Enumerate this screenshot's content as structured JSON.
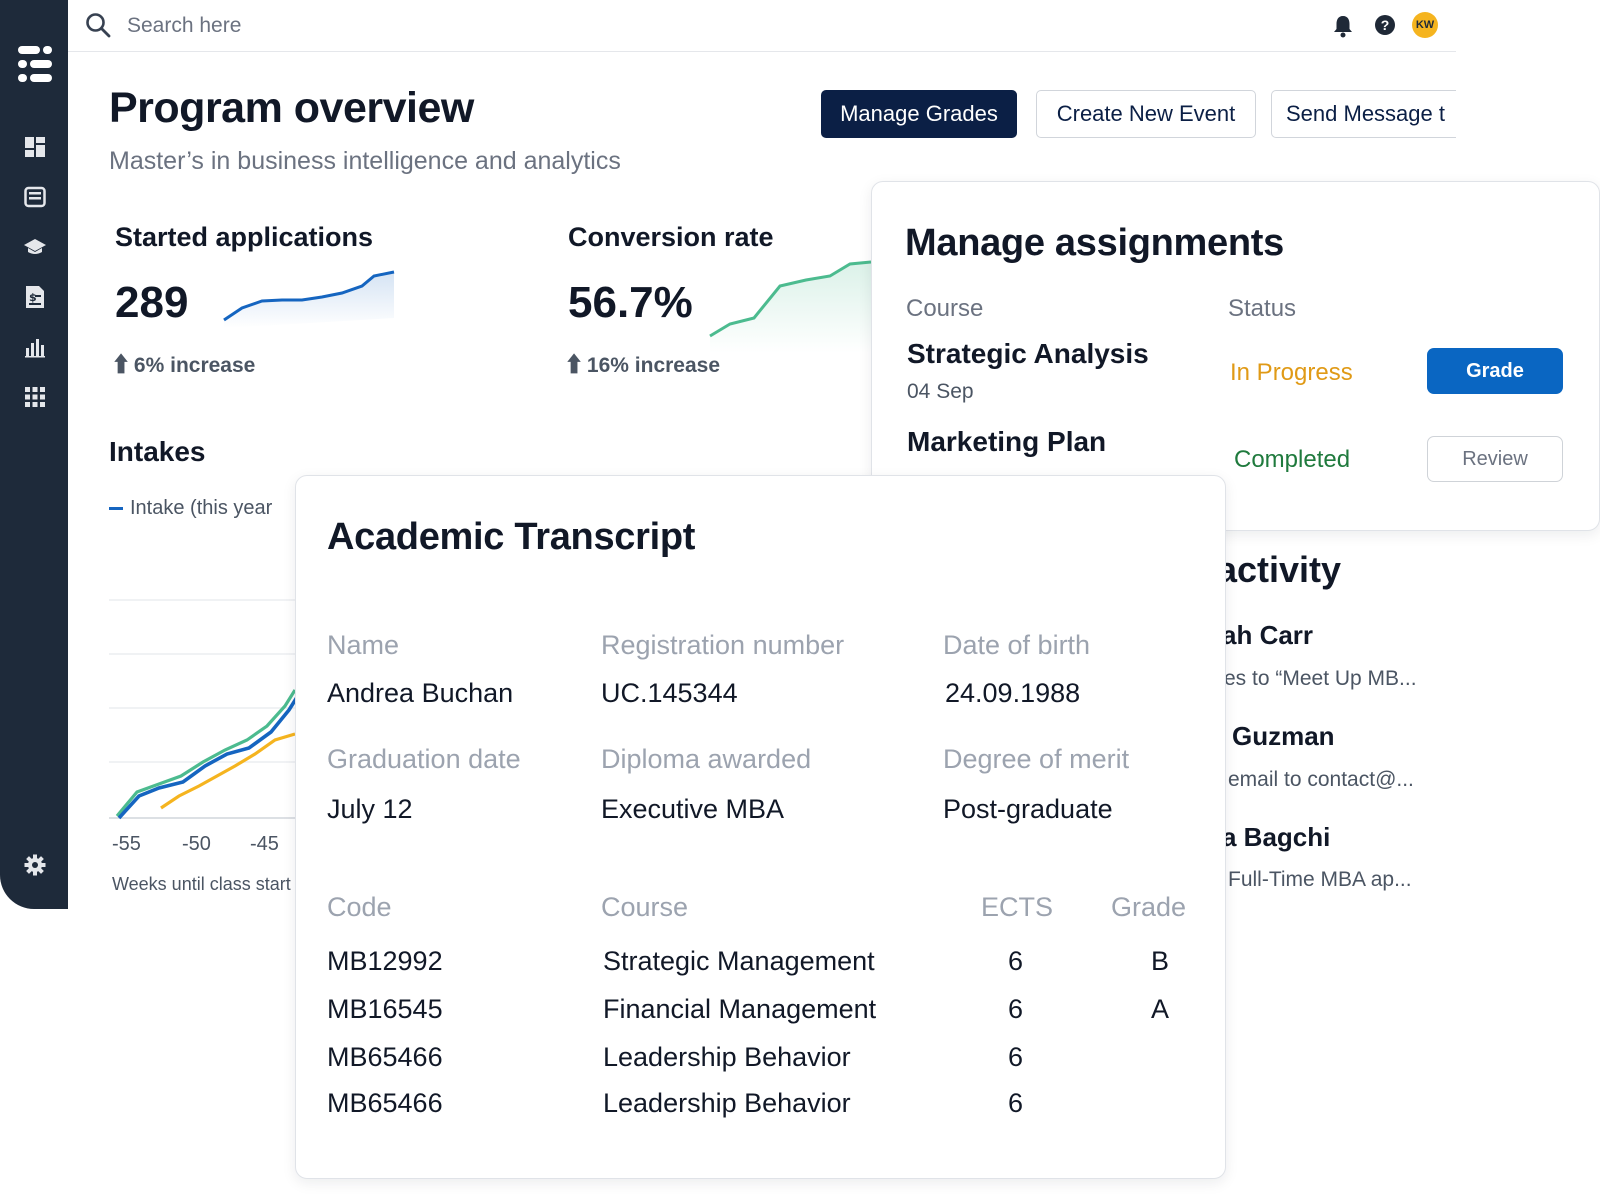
{
  "search": {
    "placeholder": "Search here"
  },
  "user": {
    "initials": "KW"
  },
  "help": {
    "glyph": "?"
  },
  "page": {
    "title": "Program overview",
    "subtitle": "Master’s in business intelligence and analytics"
  },
  "actions": {
    "manage_grades": "Manage Grades",
    "create_event": "Create New Event",
    "send_message": "Send Message t"
  },
  "kpis": [
    {
      "label": "Started applications",
      "value": "289",
      "change": "6% increase",
      "trend": "up",
      "color": "#1565c0"
    },
    {
      "label": "Conversion rate",
      "value": "56.7%",
      "change": "16% increase",
      "trend": "up",
      "color": "#4cbb8f"
    }
  ],
  "intakes": {
    "title": "Intakes",
    "legend": "Intake (this year",
    "x_ticks": [
      "-55",
      "-50",
      "-45"
    ],
    "x_label": "Weeks until class start",
    "colors": {
      "this_year": "#1565c0",
      "series_2": "#4cbb8f",
      "series_3": "#f5b41f"
    }
  },
  "assignments": {
    "title": "Manage assignments",
    "col_course": "Course",
    "col_status": "Status",
    "rows": [
      {
        "course": "Strategic Analysis",
        "date": "04 Sep",
        "status": "In Progress",
        "status_color": "#e09a16",
        "action": "Grade"
      },
      {
        "course": "Marketing Plan",
        "date": "",
        "status": "Completed",
        "status_color": "#1f7a3d",
        "action": "Review"
      }
    ]
  },
  "activity": {
    "title": "activity",
    "items": [
      {
        "name": "ah Carr",
        "desc": "es to “Meet Up MB..."
      },
      {
        "name": "Guzman",
        "desc": "email to contact@..."
      },
      {
        "name": "a Bagchi",
        "desc": "Full-Time MBA ap..."
      }
    ]
  },
  "transcript": {
    "title": "Academic Transcript",
    "fields": {
      "name_label": "Name",
      "name": "Andrea Buchan",
      "reg_label": "Registration number",
      "reg": "UC.145344",
      "dob_label": "Date of birth",
      "dob": "24.09.1988",
      "grad_label": "Graduation date",
      "grad": "July 12",
      "diploma_label": "Diploma awarded",
      "diploma": "Executive MBA",
      "merit_label": "Degree of merit",
      "merit": "Post-graduate"
    },
    "columns": {
      "code": "Code",
      "course": "Course",
      "ects": "ECTS",
      "grade": "Grade"
    },
    "rows": [
      {
        "code": "MB12992",
        "course": "Strategic Management",
        "ects": "6",
        "grade": "B"
      },
      {
        "code": "MB16545",
        "course": "Financial Management",
        "ects": "6",
        "grade": "A"
      },
      {
        "code": "MB65466",
        "course": "Leadership Behavior",
        "ects": "6",
        "grade": ""
      },
      {
        "code": "MB65466",
        "course": "Leadership Behavior",
        "ects": "6",
        "grade": ""
      }
    ]
  },
  "sidebar": {
    "items": [
      {
        "icon": "dashboard-icon"
      },
      {
        "icon": "inbox-icon"
      },
      {
        "icon": "graduation-cap-icon"
      },
      {
        "icon": "billing-icon"
      },
      {
        "icon": "analytics-icon"
      },
      {
        "icon": "apps-grid-icon"
      },
      {
        "icon": "settings-gear-icon"
      }
    ]
  }
}
